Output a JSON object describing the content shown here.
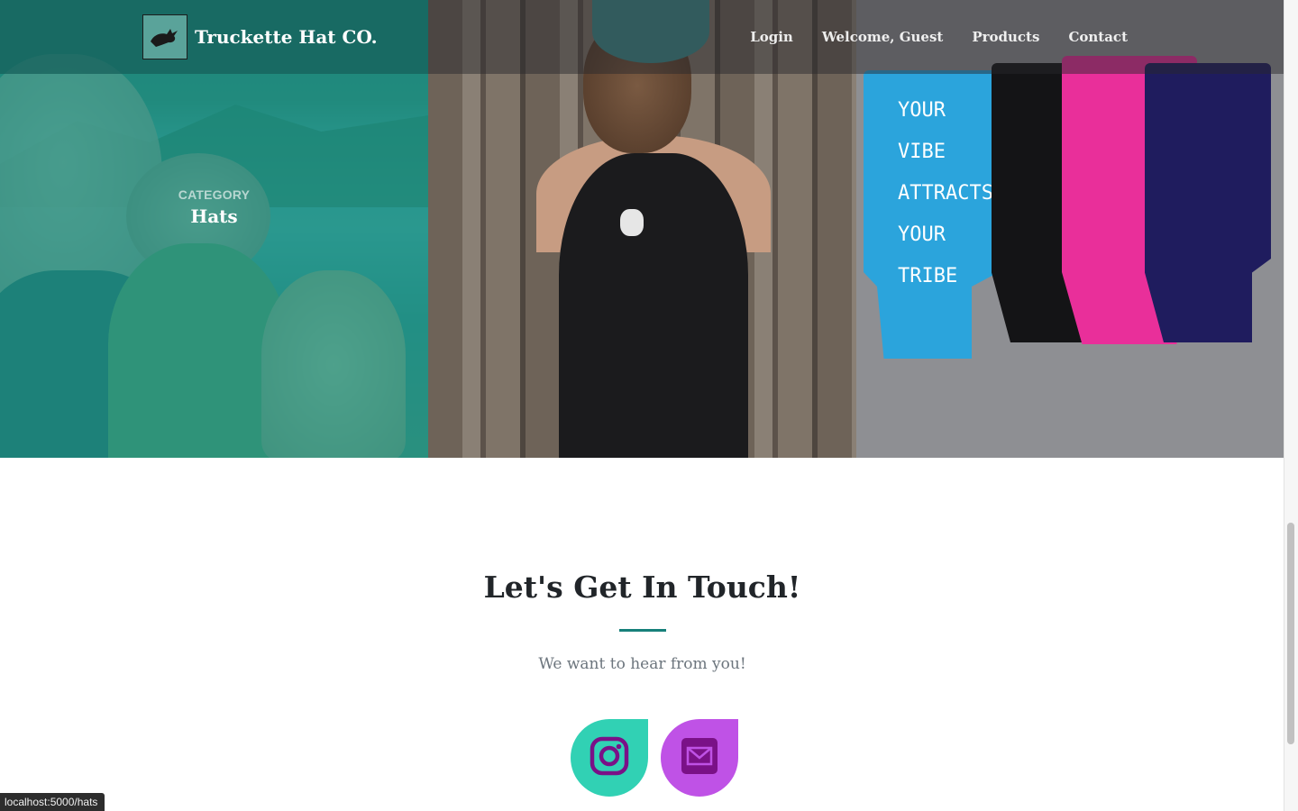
{
  "brand": {
    "name": "Truckette Hat CO.",
    "logo_icon": "jackalope-logo-icon"
  },
  "nav": {
    "items": [
      "Login",
      "Welcome, Guest",
      "Products",
      "Contact"
    ]
  },
  "gallery": {
    "tiles": [
      {
        "category_label": "CATEGORY",
        "category_name": "Hats"
      },
      {
        "image": "tank-top-photo"
      },
      {
        "image": "koozies-photo",
        "koozie_lines": [
          "YOUR VIBE",
          "ATTRACTS",
          "YOUR TRIBE"
        ]
      }
    ]
  },
  "contact": {
    "heading": "Let's Get In Touch!",
    "subheading": "We want to hear from you!",
    "social": [
      {
        "name": "instagram-icon",
        "color": "#31d1b4"
      },
      {
        "name": "mail-icon",
        "color": "#bf52e6"
      }
    ]
  },
  "colors": {
    "accent": "#17807a",
    "overlay": "#17978c"
  },
  "status_bar": {
    "url": "localhost:5000/hats"
  }
}
